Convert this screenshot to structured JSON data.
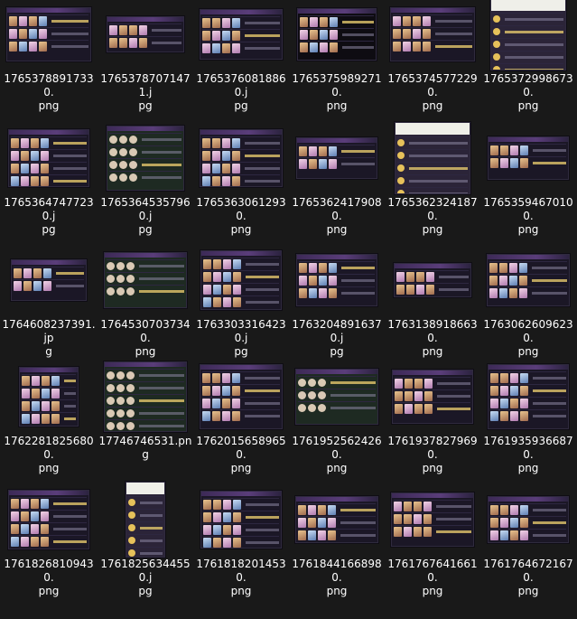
{
  "files": [
    {
      "line1": "17653788917330.",
      "line2": "png"
    },
    {
      "line1": "17653787071471.j",
      "line2": "pg"
    },
    {
      "line1": "17653760818860.j",
      "line2": "pg"
    },
    {
      "line1": "17653759892710.",
      "line2": "png"
    },
    {
      "line1": "17653745772290.",
      "line2": "png"
    },
    {
      "line1": "17653729986730.",
      "line2": "png"
    },
    {
      "line1": "17653647477230.j",
      "line2": "pg"
    },
    {
      "line1": "17653645357960.j",
      "line2": "pg"
    },
    {
      "line1": "17653630612930.",
      "line2": "png"
    },
    {
      "line1": "17653624179080.",
      "line2": "png"
    },
    {
      "line1": "17653623241870.",
      "line2": "png"
    },
    {
      "line1": "17653594670100.",
      "line2": "png"
    },
    {
      "line1": "1764608237391.jp",
      "line2": "g"
    },
    {
      "line1": "17645307037340.",
      "line2": "png"
    },
    {
      "line1": "17633033164230.j",
      "line2": "pg"
    },
    {
      "line1": "17632048916370.j",
      "line2": "pg"
    },
    {
      "line1": "17631389186630.",
      "line2": "png"
    },
    {
      "line1": "17630626096230.",
      "line2": "png"
    },
    {
      "line1": "17622818256800.",
      "line2": "png"
    },
    {
      "line1": "17746746531.png",
      "line2": ""
    },
    {
      "line1": "17620156589650.",
      "line2": "png"
    },
    {
      "line1": "17619525624260.",
      "line2": "png"
    },
    {
      "line1": "17619378279690.",
      "line2": "png"
    },
    {
      "line1": "17619359366870.",
      "line2": "png"
    },
    {
      "line1": "17618268109430.",
      "line2": "png"
    },
    {
      "line1": "17618256344550.j",
      "line2": "pg"
    },
    {
      "line1": "17618182014530.",
      "line2": "png"
    },
    {
      "line1": "17618441668980.",
      "line2": "png"
    },
    {
      "line1": "17617676416610.",
      "line2": "png"
    },
    {
      "line1": "17617646721670.",
      "line2": "png"
    }
  ],
  "colors": {
    "background": "#191919",
    "thumb_bg": "#1b1726",
    "accent_purple": "#5a3d7a",
    "gold": "#e2c66b",
    "text": "#ffffff"
  }
}
